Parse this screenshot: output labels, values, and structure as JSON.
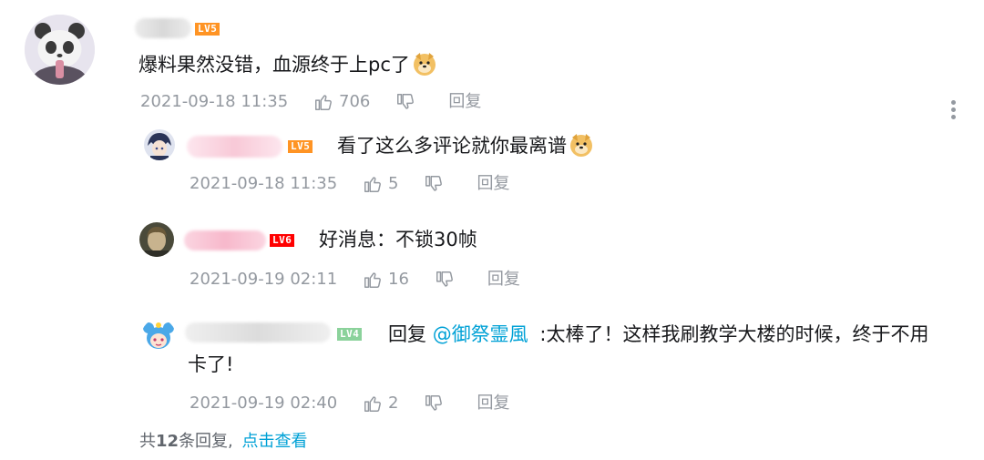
{
  "main_comment": {
    "level": "LV5",
    "text": "爆料果然没错，血源终于上pc了",
    "date": "2021-09-18 11:35",
    "likes": "706",
    "reply_label": "回复"
  },
  "replies": [
    {
      "level": "LV5",
      "text": "看了这么多评论就你最离谱",
      "date": "2021-09-18 11:35",
      "likes": "5",
      "reply_label": "回复"
    },
    {
      "level": "LV6",
      "text": "好消息：不锁30帧",
      "date": "2021-09-19 02:11",
      "likes": "16",
      "reply_label": "回复"
    },
    {
      "level": "LV4",
      "reply_prefix": "回复",
      "mention": "@御祭霊風",
      "text_line1": ":太棒了！这样我刷教学大楼的时候，终于不用",
      "text_line2": "卡了!",
      "date": "2021-09-19 02:40",
      "likes": "2",
      "reply_label": "回复"
    }
  ],
  "footer": {
    "prefix": "共",
    "count": "12",
    "suffix": "条回复,",
    "link": "点击查看"
  },
  "colors": {
    "lv4": "#8bd29b",
    "lv5": "#ff9424",
    "lv6": "#ff0000",
    "link": "#00a1d6",
    "meta": "#9499a0"
  },
  "icons": [
    "thumbs-up-icon",
    "thumbs-down-icon",
    "more-vertical-icon",
    "doge-emoji"
  ]
}
